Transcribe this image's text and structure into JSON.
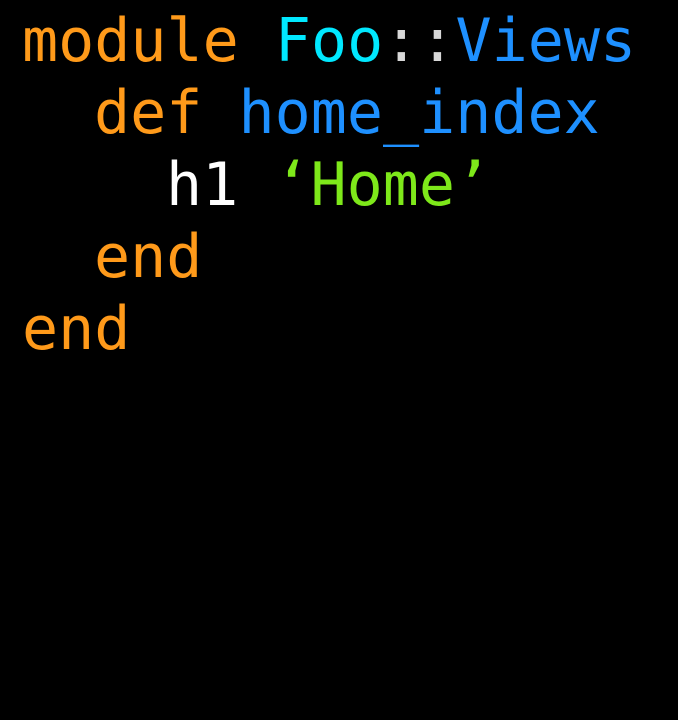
{
  "colors": {
    "background": "#000000",
    "keyword": "#ff9a1a",
    "constant_cyan": "#00e8ff",
    "constant_blue": "#1e90ff",
    "punctuation": "#d8d8d8",
    "method_name": "#1e90ff",
    "identifier": "#ffffff",
    "string": "#7ee81a"
  },
  "code": {
    "line1": {
      "keyword": "module",
      "space": " ",
      "const1": "Foo",
      "sep": "::",
      "const2": "Views"
    },
    "line2": {
      "keyword": "def",
      "space": " ",
      "method": "home_index"
    },
    "line3": {
      "call": "h1",
      "space": " ",
      "string": "‘Home’"
    },
    "line4": {
      "keyword": "end"
    },
    "line5": {
      "keyword": "end"
    }
  }
}
